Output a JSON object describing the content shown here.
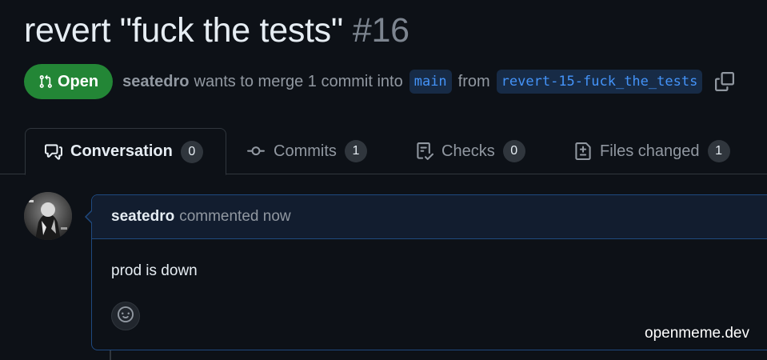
{
  "pr": {
    "title": "revert \"fuck the tests\"",
    "number": "#16",
    "state": "Open",
    "author": "seatedro",
    "merge_text": "wants to merge 1 commit into",
    "base_branch": "main",
    "from_text": "from",
    "head_branch": "revert-15-fuck_the_tests"
  },
  "tabs": [
    {
      "label": "Conversation",
      "count": "0",
      "icon": "comment-discussion-icon",
      "active": true
    },
    {
      "label": "Commits",
      "count": "1",
      "icon": "git-commit-icon",
      "active": false
    },
    {
      "label": "Checks",
      "count": "0",
      "icon": "checklist-icon",
      "active": false
    },
    {
      "label": "Files changed",
      "count": "1",
      "icon": "file-diff-icon",
      "active": false
    }
  ],
  "comment": {
    "author": "seatedro",
    "time": "commented now",
    "body": "prod is down"
  },
  "watermark": "openmeme.dev",
  "colors": {
    "background": "#0d1117",
    "open_badge": "#238636",
    "branch_text": "#4493f8",
    "branch_bg": "#172b46",
    "comment_border": "#1f4a80"
  }
}
